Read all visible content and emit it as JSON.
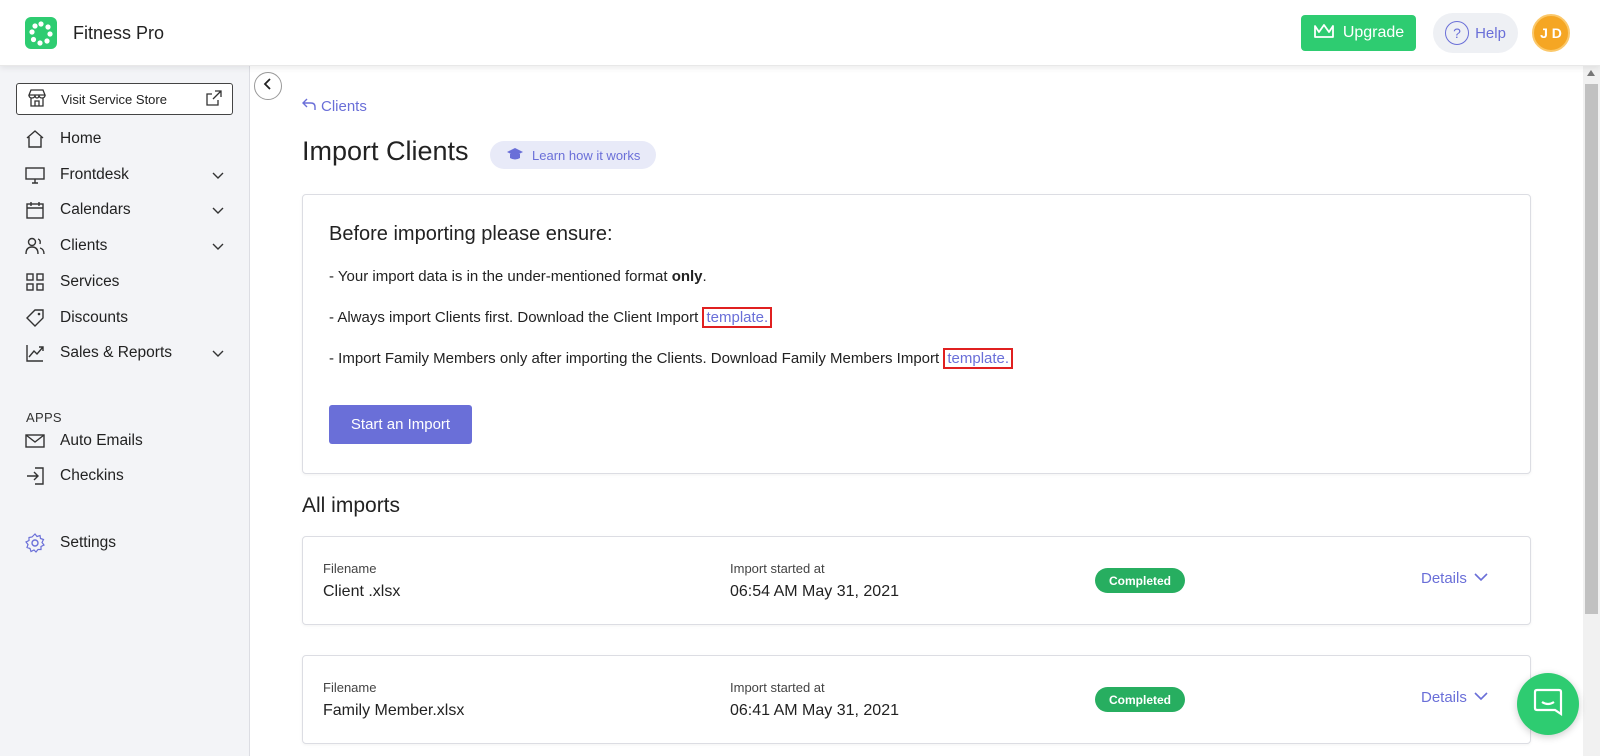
{
  "header": {
    "app_name": "Fitness Pro",
    "upgrade_label": "Upgrade",
    "help_label": "Help",
    "avatar_initials": "J D",
    "brand_color": "#2ecc71",
    "accent_color": "#6a6fd8",
    "avatar_color": "#f5a623"
  },
  "sidebar": {
    "store_button_label": "Visit Service Store",
    "items": [
      {
        "label": "Home",
        "icon": "home-icon",
        "has_chevron": false
      },
      {
        "label": "Frontdesk",
        "icon": "monitor-icon",
        "has_chevron": true
      },
      {
        "label": "Calendars",
        "icon": "calendar-icon",
        "has_chevron": true
      },
      {
        "label": "Clients",
        "icon": "users-icon",
        "has_chevron": true
      },
      {
        "label": "Services",
        "icon": "grid-icon",
        "has_chevron": false
      },
      {
        "label": "Discounts",
        "icon": "tag-icon",
        "has_chevron": false
      },
      {
        "label": "Sales & Reports",
        "icon": "chart-icon",
        "has_chevron": true
      }
    ],
    "apps_heading": "APPS",
    "apps": [
      {
        "label": "Auto Emails",
        "icon": "mail-icon"
      },
      {
        "label": "Checkins",
        "icon": "sign-in-icon"
      }
    ],
    "settings_label": "Settings"
  },
  "main": {
    "breadcrumb": "Clients",
    "title": "Import Clients",
    "learn_label": "Learn how it works",
    "ensure": {
      "title": "Before importing please ensure:",
      "line1_prefix": "- Your import data is in the under-mentioned format ",
      "line1_bold": "only",
      "line1_suffix": ".",
      "line2_prefix": "- Always import Clients first. Download the Client Import ",
      "line2_link": "template.",
      "line3_prefix": "- Import Family Members only after importing the Clients. Download Family Members Import ",
      "line3_link": "template.",
      "start_button": "Start an Import"
    },
    "all_imports_title": "All imports",
    "imports": [
      {
        "filename_label": "Filename",
        "filename": "Client .xlsx",
        "started_label": "Import started at",
        "started_at": "06:54 AM May 31, 2021",
        "status": "Completed",
        "details_label": "Details"
      },
      {
        "filename_label": "Filename",
        "filename": "Family Member.xlsx",
        "started_label": "Import started at",
        "started_at": "06:41 AM May 31, 2021",
        "status": "Completed",
        "details_label": "Details"
      }
    ]
  }
}
